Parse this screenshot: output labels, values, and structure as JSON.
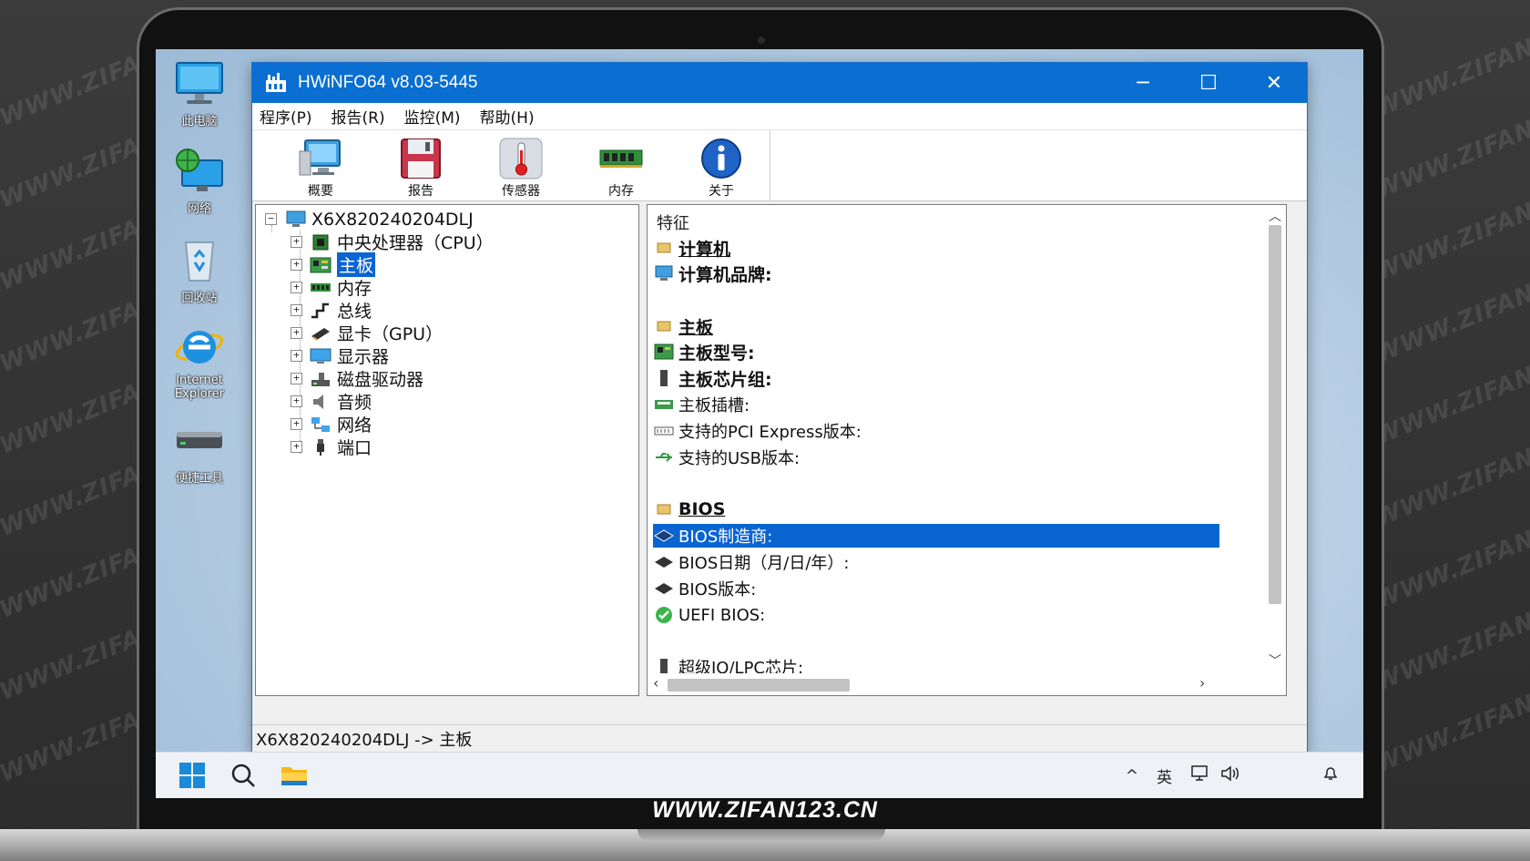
{
  "watermark": "WWW.ZIFAN123.CN",
  "caption": "WWW.ZIFAN123.CN",
  "desktop": {
    "icons": [
      {
        "label": "此电脑",
        "icon": "monitor-icon"
      },
      {
        "label": "网络",
        "icon": "network-globe-icon"
      },
      {
        "label": "回收站",
        "icon": "recycle-bin-icon"
      },
      {
        "label": "Internet Explorer",
        "icon": "internet-explorer-icon"
      },
      {
        "label": "便捷工具",
        "icon": "drive-icon"
      }
    ]
  },
  "window": {
    "title": "HWiNFO64 v8.03-5445",
    "controls": {
      "minimize": "─",
      "maximize": "☐",
      "close": "✕"
    },
    "menu": [
      "程序(P)",
      "报告(R)",
      "监控(M)",
      "帮助(H)"
    ],
    "toolbar": [
      {
        "label": "概要",
        "icon": "summary-monitor-icon"
      },
      {
        "label": "报告",
        "icon": "save-report-icon"
      },
      {
        "label": "传感器",
        "icon": "thermometer-icon"
      },
      {
        "label": "内存",
        "icon": "memory-module-icon"
      },
      {
        "label": "关于",
        "icon": "info-icon"
      }
    ],
    "tree": {
      "root": "X6X820240204DLJ",
      "items": [
        {
          "label": "中央处理器（CPU）",
          "icon": "cpu-chip-icon"
        },
        {
          "label": "主板",
          "icon": "motherboard-icon",
          "selected": true
        },
        {
          "label": "内存",
          "icon": "ram-icon"
        },
        {
          "label": "总线",
          "icon": "bus-icon"
        },
        {
          "label": "显卡（GPU）",
          "icon": "gpu-card-icon"
        },
        {
          "label": "显示器",
          "icon": "display-icon"
        },
        {
          "label": "磁盘驱动器",
          "icon": "disk-drive-icon"
        },
        {
          "label": "音频",
          "icon": "speaker-icon"
        },
        {
          "label": "网络",
          "icon": "network-adapter-icon"
        },
        {
          "label": "端口",
          "icon": "usb-port-icon"
        }
      ]
    },
    "details": {
      "header": "特征",
      "rows": [
        {
          "text": "计算机",
          "style": "section",
          "icon": "folder-section-icon"
        },
        {
          "text": "计算机品牌:",
          "style": "bold",
          "icon": "computer-icon"
        },
        {
          "text": "",
          "style": "blank"
        },
        {
          "text": "主板",
          "style": "section",
          "icon": "folder-section-icon"
        },
        {
          "text": "主板型号:",
          "style": "bold",
          "icon": "motherboard-icon"
        },
        {
          "text": "主板芯片组:",
          "style": "bold",
          "icon": "chipset-icon"
        },
        {
          "text": "主板插槽:",
          "style": "normal",
          "icon": "slot-icon"
        },
        {
          "text": "支持的PCI Express版本:",
          "style": "normal",
          "icon": "pci-icon"
        },
        {
          "text": "支持的USB版本:",
          "style": "normal",
          "icon": "usb-icon"
        },
        {
          "text": "",
          "style": "blank"
        },
        {
          "text": "BIOS",
          "style": "section",
          "icon": "folder-section-icon"
        },
        {
          "text": "BIOS制造商:",
          "style": "highlight",
          "icon": "bios-chip-icon"
        },
        {
          "text": "BIOS日期（月/日/年）:",
          "style": "normal",
          "icon": "bios-chip-icon"
        },
        {
          "text": "BIOS版本:",
          "style": "normal",
          "icon": "bios-chip-icon"
        },
        {
          "text": "UEFI BIOS:",
          "style": "normal",
          "icon": "check-icon"
        },
        {
          "text": "",
          "style": "blank"
        },
        {
          "text": "超级IO/LPC芯片:",
          "style": "normal",
          "icon": "chipset-icon"
        }
      ]
    },
    "status": "X6X820240204DLJ -> 主板"
  },
  "taskbar": {
    "icons": [
      "windows-start-icon",
      "search-icon",
      "file-explorer-icon"
    ],
    "tray": {
      "chevron": "^",
      "ime": "英",
      "network": "network-tray-icon",
      "volume": "volume-icon",
      "notify": "notification-icon"
    }
  }
}
